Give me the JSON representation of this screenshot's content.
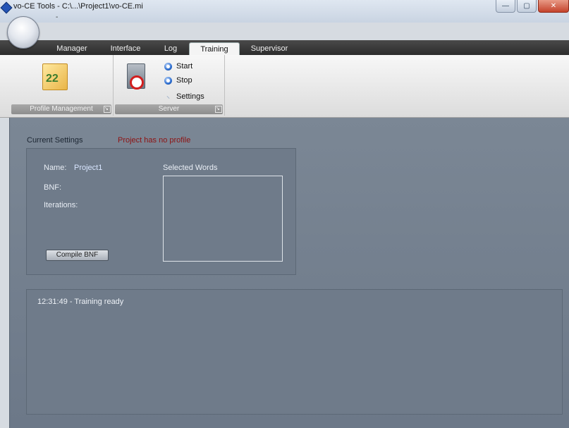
{
  "window": {
    "title": "vo-CE Tools - C:\\...\\Project1\\vo-CE.mi",
    "minimize_glyph": "—",
    "maximize_glyph": "▢",
    "close_glyph": "✕"
  },
  "quick_access": {
    "glyph": "-"
  },
  "tabs": [
    {
      "label": "Manager"
    },
    {
      "label": "Interface"
    },
    {
      "label": "Log"
    },
    {
      "label": "Training"
    },
    {
      "label": "Supervisor"
    }
  ],
  "ribbon": {
    "profile_group": {
      "label": "Profile Management",
      "icon_text": "22"
    },
    "server_group": {
      "label": "Server",
      "start_label": "Start",
      "stop_label": "Stop",
      "settings_label": "Settings"
    }
  },
  "main": {
    "current_settings_label": "Current Settings",
    "profile_status": "Project has no profile",
    "name_label": "Name:",
    "name_value": "Project1",
    "bnf_label": "BNF:",
    "iterations_label": "Iterations:",
    "selected_words_label": "Selected Words",
    "compile_button": "Compile BNF",
    "log_lines": [
      "12:31:49 - Training ready"
    ]
  },
  "colors": {
    "accent": "#2454b6",
    "status_red": "#8e1212",
    "panel_bg": "#6f7b8a"
  }
}
